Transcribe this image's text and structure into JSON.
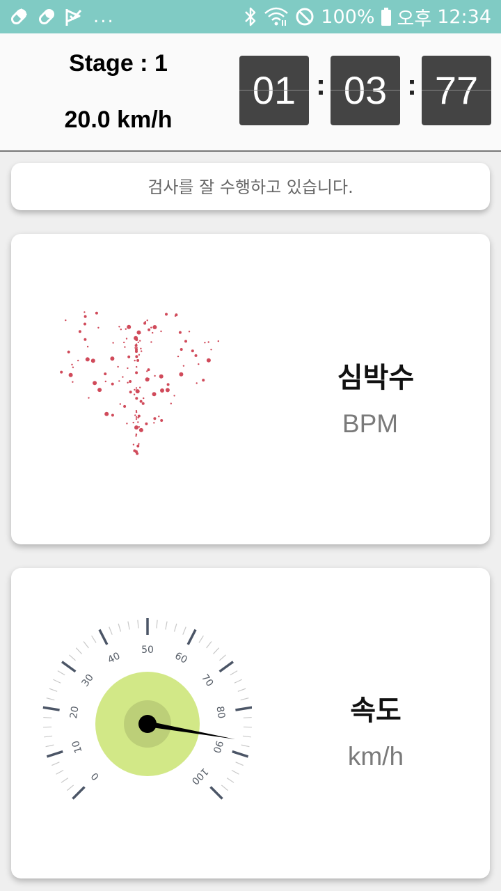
{
  "status_bar": {
    "left_icons": [
      "pill-icon",
      "pill-icon",
      "check-flag-icon"
    ],
    "more": "...",
    "right_icons": [
      "bluetooth-icon",
      "wifi-icon",
      "do-not-disturb-icon"
    ],
    "battery": "100%",
    "ampm": "오후",
    "time": "12:34"
  },
  "header": {
    "stage": "Stage : 1",
    "speed": "20.0 km/h",
    "timer": {
      "minutes": "01",
      "seconds": "03",
      "centis": "77",
      "separator": ":"
    }
  },
  "message": "검사를 잘 수행하고 있습니다.",
  "heart_card": {
    "title": "심박수",
    "unit": "BPM",
    "icon": "heart-particles-icon",
    "color": "#d04a5a"
  },
  "speed_card": {
    "title": "속도",
    "unit": "km/h",
    "gauge": {
      "ticks": [
        "0",
        "10",
        "20",
        "30",
        "40",
        "50",
        "60",
        "70",
        "80",
        "90",
        "100"
      ],
      "value": 87,
      "min": 0,
      "max": 100,
      "dial_color": "#d2e887",
      "hub_color": "#000000"
    }
  },
  "colors": {
    "status_bar": "#80cbc4",
    "timer_box": "#444444"
  }
}
